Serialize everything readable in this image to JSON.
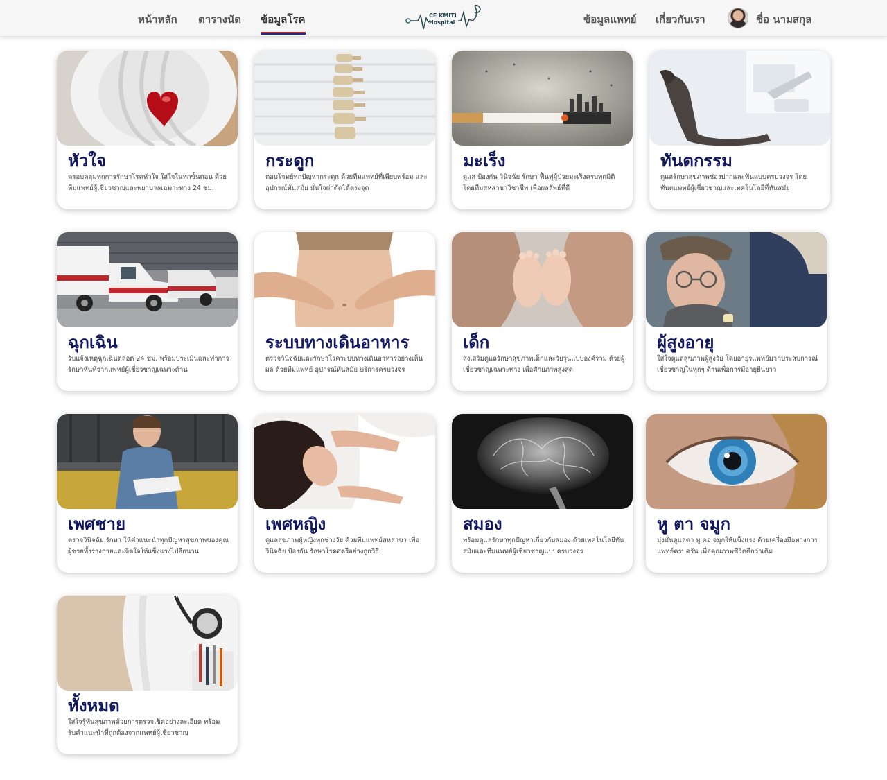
{
  "nav": {
    "home": "หน้าหลัก",
    "schedule": "ตารางนัด",
    "disease_info": "ข้อมูลโรค",
    "doctor_info": "ข้อมูลแพทย์",
    "about": "เกี่ยวกับเรา",
    "user_name": "ชื่อ นามสกุล",
    "logo_line1": "CE KMITL",
    "logo_line2": "Hospital"
  },
  "cards": [
    {
      "title": "หัวใจ",
      "desc": "ครอบคลุมทุกการรักษาโรคหัวใจ ใส่ใจในทุกขั้นตอน ด้วยทีมแพทย์ผู้เชี่ยวชาญและพยาบาลเฉพาะทาง 24 ชม."
    },
    {
      "title": "กระดูก",
      "desc": "ตอบโจทย์ทุกปัญหากระดูก ด้วยทีมแพทย์ที่เพียบพร้อม และอุปกรณ์ทันสมัย มั่นใจผ่าตัดได้ตรงจุด"
    },
    {
      "title": "มะเร็ง",
      "desc": "ดูแล ป้องกัน วินิจฉัย รักษา ฟื้นฟูผู้ป่วยมะเร็งครบทุกมิติ โดยทีมสหสาขาวิชาชีพ เพื่อผลลัพธ์ที่ดี"
    },
    {
      "title": "ทันตกรรม",
      "desc": "ดูแลรักษาสุขภาพช่องปากและฟันแบบครบวงจร โดยทันตแพทย์ผู้เชี่ยวชาญและเทคโนโลยีที่ทันสมัย"
    },
    {
      "title": "ฉุกเฉิน",
      "desc": "รับแจ้งเหตุฉุกเฉินตลอด 24 ชม. พร้อมประเมินและทำการรักษาทันทีจากแพทย์ผู้เชี่ยวชาญเฉพาะด้าน"
    },
    {
      "title": "ระบบทางเดินอาหาร",
      "desc": "ตรวจวินิจฉัยและรักษาโรคระบบทางเดินอาหารอย่างเห็นผล ด้วยทีมแพทย์ อุปกรณ์ทันสมัย บริการครบวงจร"
    },
    {
      "title": "เด็ก",
      "desc": "ส่งเสริมดูแลรักษาสุขภาพเด็กและวัยรุ่นแบบองค์รวม ด้วยผู้เชี่ยวชาญเฉพาะทาง เพื่อศักยภาพสูงสุด"
    },
    {
      "title": "ผู้สูงอายุ",
      "desc": "ใส่ใจดูแลสุขภาพผู้สูงวัย โดยอายุรแพทย์มากประสบการณ์เชี่ยวชาญในทุกๆ ด้านเพื่อการมีอายุยืนยาว"
    },
    {
      "title": "เพศชาย",
      "desc": "ตรวจวินิจฉัย รักษา ให้คำแนะนำทุกปัญหาสุขภาพของคุณผู้ชายทั้งร่างกายและจิตใจให้แข็งแรงไปอีกนาน"
    },
    {
      "title": "เพศหญิง",
      "desc": "ดูแลสุขภาพผู้หญิงทุกช่วงวัย ด้วยทีมแพทย์สหสาขา เพื่อวินิจฉัย ป้องกัน รักษาโรคสตรีอย่างถูกวิธี"
    },
    {
      "title": "สมอง",
      "desc": "พร้อมดูแลรักษาทุกปัญหาเกี่ยวกับสมอง ด้วยเทคโนโลยีทันสมัยและทีมแพทย์ผู้เชี่ยวชาญแบบครบวงจร"
    },
    {
      "title": "หู ตา จมูก",
      "desc": "มุ่งมั่นดูแลตา หู คอ จมูกให้แข็งแรง ด้วยเครื่องมือทางการแพทย์ครบครัน เพื่อคุณภาพชีวิตดีกว่าเดิม"
    },
    {
      "title": "ทั้งหมด",
      "desc": "ใส่ใจรู้ทันสุขภาพด้วยการตรวจเช็คอย่างละเอียด พร้อมรับคำแนะนำที่ถูกต้องจากแพทย์ผู้เชี่ยวชาญ"
    }
  ]
}
